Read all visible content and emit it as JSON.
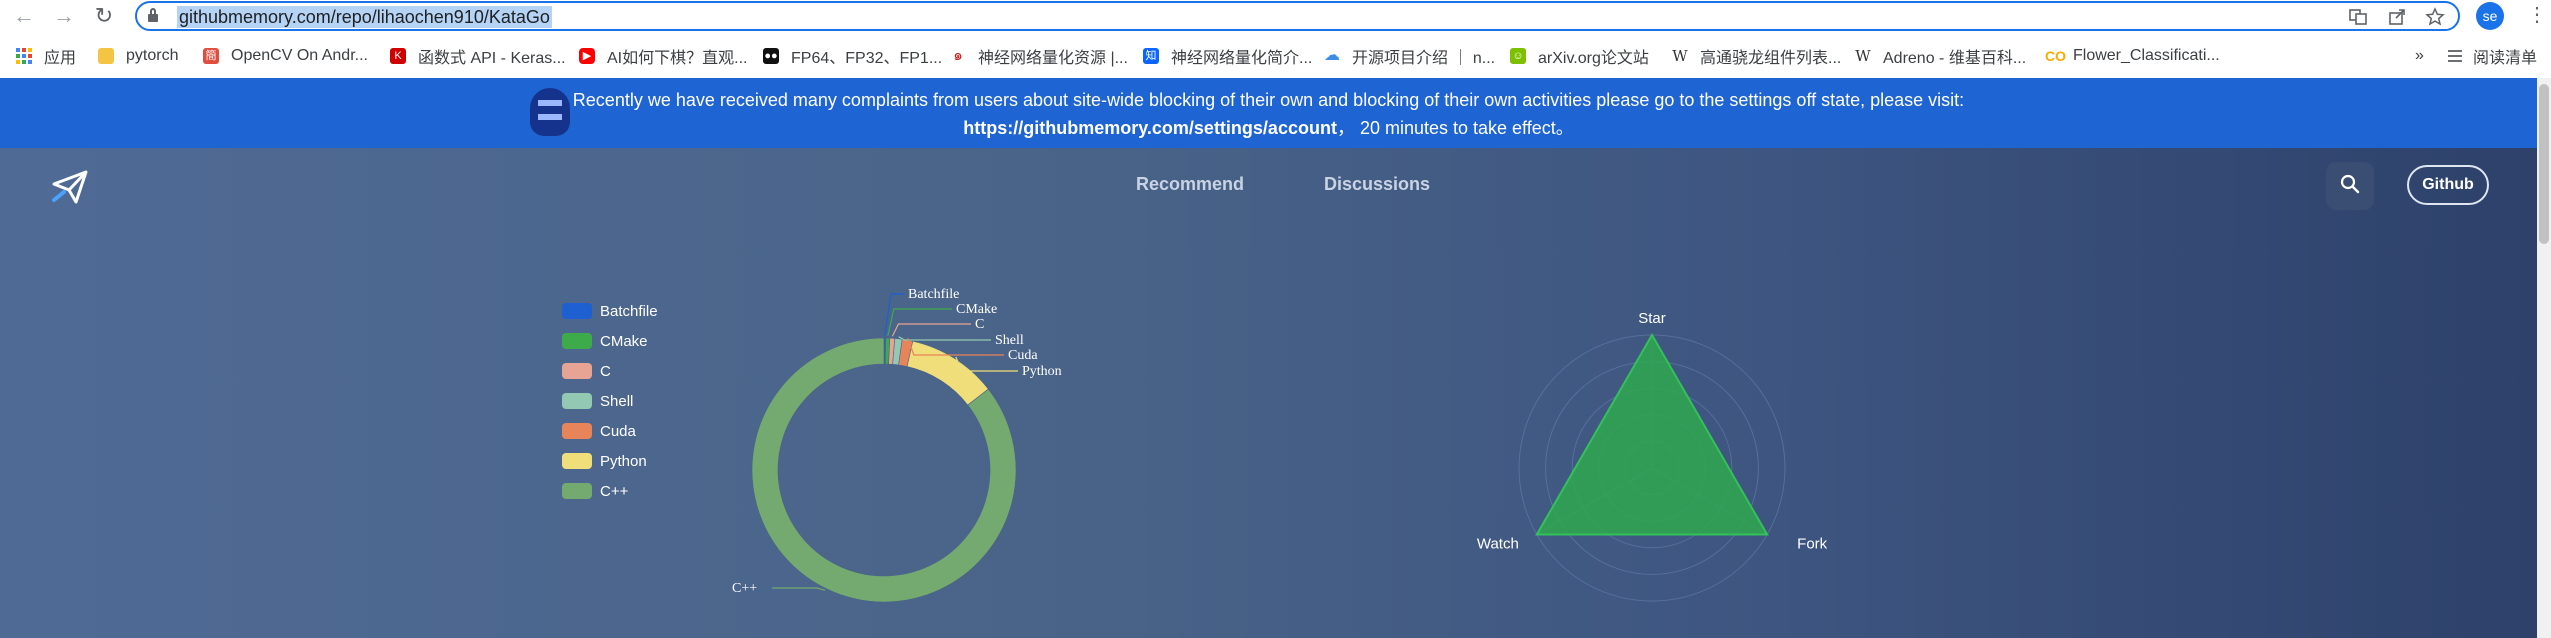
{
  "browser": {
    "url": "githubmemory.com/repo/lihaochen910/KataGo",
    "avatar_initials": "se",
    "nav": {
      "back": "←",
      "forward": "→",
      "reload": "↻"
    },
    "toolbar_icons": [
      "translate-icon",
      "share-icon",
      "star-icon"
    ],
    "bookmarks": [
      {
        "label": "应用",
        "icon": "apps-grid-icon",
        "color": "#4285f4"
      },
      {
        "label": "pytorch",
        "icon": "folder-icon",
        "color": "#f4c542"
      },
      {
        "label": "OpenCV On Andr...",
        "icon": "jianshu-icon",
        "color": "#e04c3d"
      },
      {
        "label": "函数式 API - Keras...",
        "icon": "keras-icon",
        "color": "#d00000"
      },
      {
        "label": "AI如何下棋？直观...",
        "icon": "youtube-icon",
        "color": "#ff0000"
      },
      {
        "label": "FP64、FP32、FP1...",
        "icon": "dots-icon",
        "color": "#111111"
      },
      {
        "label": "神经网络量化资源 |...",
        "icon": "swirl-icon",
        "color": "#c81e1e"
      },
      {
        "label": "神经网络量化简介...",
        "icon": "zhihu-icon",
        "color": "#0a66ff"
      },
      {
        "label": "开源项目介绍 ｜ n...",
        "icon": "cloud-icon",
        "color": "#3c8ce7"
      },
      {
        "label": "arXiv.org论文站",
        "icon": "arxiv-icon",
        "color": "#7cc000"
      },
      {
        "label": "高通骁龙组件列表...",
        "icon": "wikipedia-icon",
        "color": "#333333"
      },
      {
        "label": "Adreno - 维基百科...",
        "icon": "wikipedia-icon",
        "color": "#333333"
      },
      {
        "label": "Flower_Classificati...",
        "icon": "colab-icon",
        "color": "#f9ab00"
      }
    ],
    "bookmarks_overflow": "»",
    "reading_list": "阅读清单"
  },
  "banner": {
    "line1": "Recently we have received many complaints from users about site-wide blocking of their own and blocking of their own activities please go to the settings off state, please visit:",
    "line2_link": "https://githubmemory.com/settings/account",
    "line2_rest": "，  20 minutes to take effect。"
  },
  "site": {
    "nav": [
      "Recommend",
      "Discussions"
    ],
    "github_button": "Github",
    "colors": {
      "accent": "#1e64d2"
    }
  },
  "chart_data": [
    {
      "type": "pie",
      "categories": [
        "Batchfile",
        "CMake",
        "C",
        "Shell",
        "Cuda",
        "Python",
        "C++"
      ],
      "values": [
        0.2,
        0.5,
        0.6,
        0.9,
        1.3,
        11.0,
        85.5
      ],
      "colors": [
        "#1e5fd1",
        "#3dab4a",
        "#e7a394",
        "#93c9b2",
        "#e8845a",
        "#f0de7a",
        "#74a96f"
      ],
      "legend": "left"
    },
    {
      "type": "radar",
      "indicators": [
        "Star",
        "Fork",
        "Watch"
      ],
      "values": [
        1,
        1,
        1
      ],
      "color": "#2fa84f"
    }
  ]
}
